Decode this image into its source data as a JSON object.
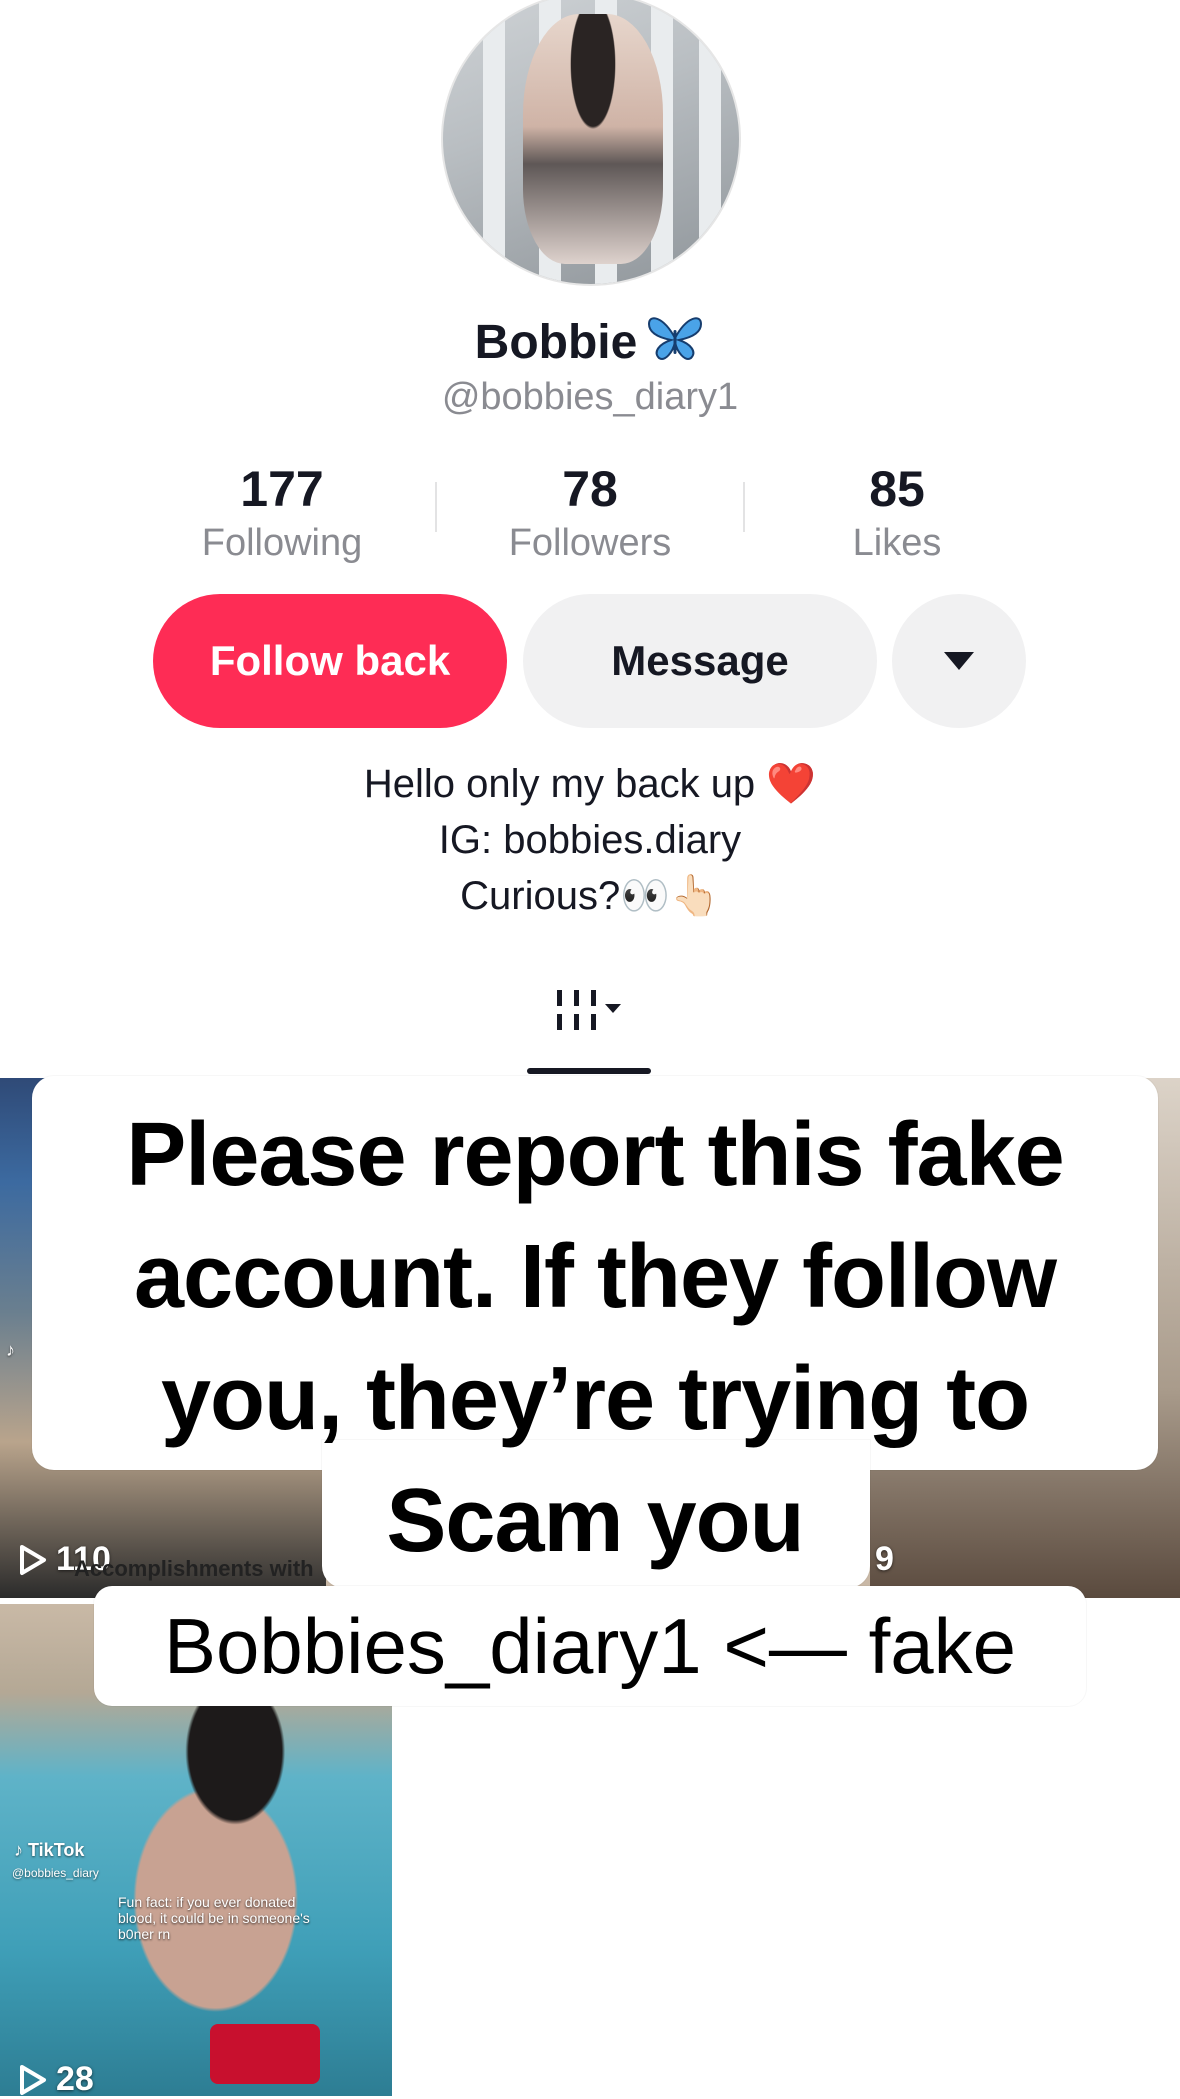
{
  "profile": {
    "display_name": "Bobbie",
    "username": "@bobbies_diary1",
    "stats": [
      {
        "value": "177",
        "label": "Following"
      },
      {
        "value": "78",
        "label": "Followers"
      },
      {
        "value": "85",
        "label": "Likes"
      }
    ],
    "bio_lines": [
      "Hello only my back up ❤️",
      "IG: bobbies.diary",
      "Curious?👀👆🏻"
    ]
  },
  "actions": {
    "follow_back_label": "Follow back",
    "message_label": "Message",
    "more_icon": "caret-down-icon"
  },
  "tabs": {
    "grid_icon": "grid-filter-icon"
  },
  "videos": [
    {
      "views": "110",
      "caption": "Accomplishments with"
    },
    {
      "views": "9"
    },
    {
      "views": "28",
      "caption": "Fun fact: if you ever donated blood, it could be in someone's b0ner rn",
      "watermark": "TikTok",
      "watermark_user": "@bobbies_diary"
    }
  ],
  "overlay": {
    "warning": "Please report this fake account. If they follow you, they’re trying to Scam you",
    "label": "Bobbies_diary1 <— fake"
  },
  "colors": {
    "accent": "#fe2c55",
    "secondary_button": "#f1f1f2",
    "muted_text": "#8a8b91"
  }
}
